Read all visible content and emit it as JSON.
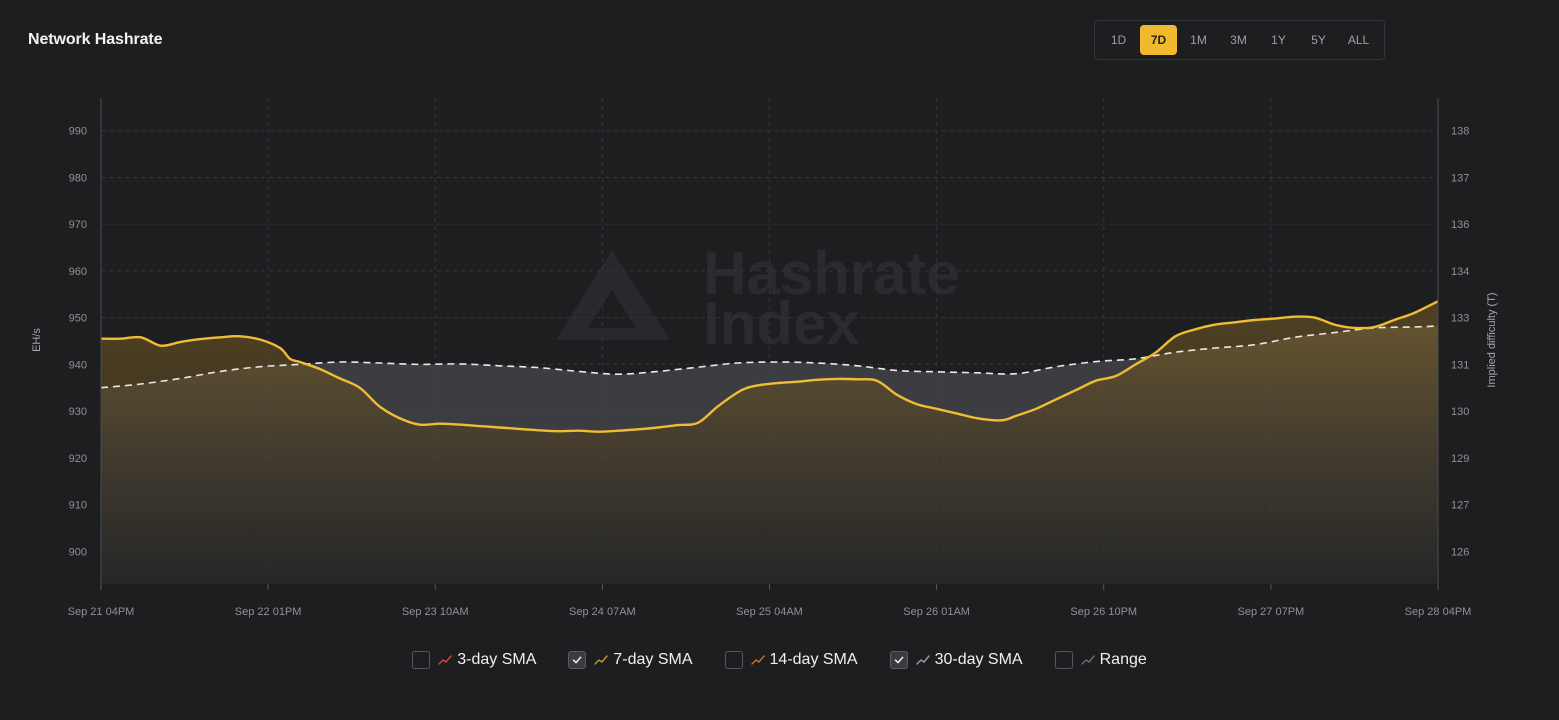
{
  "header": {
    "title": "Network Hashrate"
  },
  "range_selector": {
    "options": [
      "1D",
      "7D",
      "1M",
      "3M",
      "1Y",
      "5Y",
      "ALL"
    ],
    "active": "7D"
  },
  "watermark": {
    "line1": "Hashrate",
    "line2": "Index"
  },
  "legend": {
    "items": [
      {
        "label": "3-day SMA",
        "checked": false,
        "color": "#c94a3a",
        "icon": "trend-line-icon"
      },
      {
        "label": "7-day SMA",
        "checked": true,
        "color": "#c9952e",
        "icon": "trend-line-icon"
      },
      {
        "label": "14-day SMA",
        "checked": false,
        "color": "#c9702e",
        "icon": "trend-line-icon"
      },
      {
        "label": "30-day SMA",
        "checked": true,
        "color": "#9a9ca1",
        "icon": "trend-line-icon"
      },
      {
        "label": "Range",
        "checked": false,
        "color": "#6c6e72",
        "icon": "trend-line-icon"
      }
    ]
  },
  "chart_data": {
    "type": "line",
    "title": "Network Hashrate",
    "ylabel": "EH/s",
    "y2label": "Implied difficulty (T)",
    "ylim": [
      893,
      997
    ],
    "yticks": [
      900,
      910,
      920,
      930,
      940,
      950,
      960,
      970,
      980,
      990
    ],
    "y2ticks": [
      {
        "label": "126",
        "at": 900
      },
      {
        "label": "127",
        "at": 910
      },
      {
        "label": "129",
        "at": 920
      },
      {
        "label": "130",
        "at": 930
      },
      {
        "label": "131",
        "at": 940
      },
      {
        "label": "133",
        "at": 950
      },
      {
        "label": "134",
        "at": 960
      },
      {
        "label": "136",
        "at": 970
      },
      {
        "label": "137",
        "at": 980
      },
      {
        "label": "138",
        "at": 990
      }
    ],
    "xlim": [
      0,
      168
    ],
    "xticks": [
      {
        "label": "Sep 21 04PM",
        "at": 0
      },
      {
        "label": "Sep 22 01PM",
        "at": 21
      },
      {
        "label": "Sep 23 10AM",
        "at": 42
      },
      {
        "label": "Sep 24 07AM",
        "at": 63
      },
      {
        "label": "Sep 25 04AM",
        "at": 84
      },
      {
        "label": "Sep 26 01AM",
        "at": 105
      },
      {
        "label": "Sep 26 10PM",
        "at": 126
      },
      {
        "label": "Sep 27 07PM",
        "at": 147
      },
      {
        "label": "Sep 28 04PM",
        "at": 168
      }
    ],
    "grid": true,
    "series": [
      {
        "name": "7-day SMA",
        "color": "#f0bc36",
        "style": "solid",
        "x": [
          0,
          2.5,
          5,
          7.5,
          10,
          12.5,
          15,
          17.5,
          20,
          22.5,
          23.75,
          25,
          27.5,
          30,
          32.5,
          35,
          37.5,
          40,
          42.5,
          45,
          47.5,
          50,
          52.5,
          55,
          57.5,
          60,
          62.5,
          65,
          67.5,
          70,
          72.5,
          75,
          77.5,
          80,
          81.25,
          82.5,
          85,
          87.5,
          90,
          92.5,
          95,
          97.5,
          100,
          102.5,
          105,
          107.5,
          110,
          112.5,
          113.75,
          115,
          117.5,
          120,
          122.5,
          125,
          127.5,
          130,
          132.5,
          135,
          137.5,
          140,
          142.5,
          145,
          147.5,
          150,
          152.5,
          155,
          157.5,
          160,
          162.5,
          165,
          168
        ],
        "y": [
          945.5,
          945.5,
          945.8,
          944.0,
          944.8,
          945.4,
          945.8,
          946.0,
          945.3,
          943.5,
          941.2,
          940.5,
          939.0,
          937.0,
          935.0,
          931.0,
          928.5,
          927.1,
          927.3,
          927.1,
          926.8,
          926.5,
          926.2,
          925.9,
          925.7,
          925.8,
          925.6,
          925.8,
          926.1,
          926.5,
          927.0,
          927.5,
          931.0,
          934.0,
          935.0,
          935.5,
          936.0,
          936.3,
          936.7,
          936.9,
          936.8,
          936.5,
          933.5,
          931.5,
          930.5,
          929.5,
          928.5,
          928.0,
          928.2,
          929.0,
          930.5,
          932.5,
          934.5,
          936.5,
          937.5,
          940.0,
          942.5,
          946.0,
          947.5,
          948.5,
          949.0,
          949.5,
          949.8,
          950.2,
          950.0,
          948.5,
          947.8,
          948.0,
          949.5,
          951.0,
          953.5
        ]
      },
      {
        "name": "30-day SMA",
        "color": "#e8e8e8",
        "style": "dashed",
        "x": [
          0,
          5,
          10,
          15,
          20,
          25,
          30,
          35,
          40,
          45,
          50,
          55,
          60,
          65,
          70,
          75,
          80,
          85,
          90,
          95,
          100,
          105,
          110,
          115,
          120,
          125,
          130,
          135,
          140,
          145,
          150,
          155,
          160,
          165,
          168
        ],
        "y": [
          935.0,
          935.8,
          937.0,
          938.5,
          939.5,
          940.0,
          940.5,
          940.3,
          940.0,
          940.1,
          939.7,
          939.3,
          938.5,
          937.9,
          938.5,
          939.4,
          940.3,
          940.5,
          940.3,
          939.7,
          938.7,
          938.4,
          938.2,
          938.0,
          939.5,
          940.6,
          941.2,
          942.6,
          943.5,
          944.2,
          945.8,
          946.8,
          947.8,
          948.0,
          948.2
        ]
      }
    ]
  }
}
